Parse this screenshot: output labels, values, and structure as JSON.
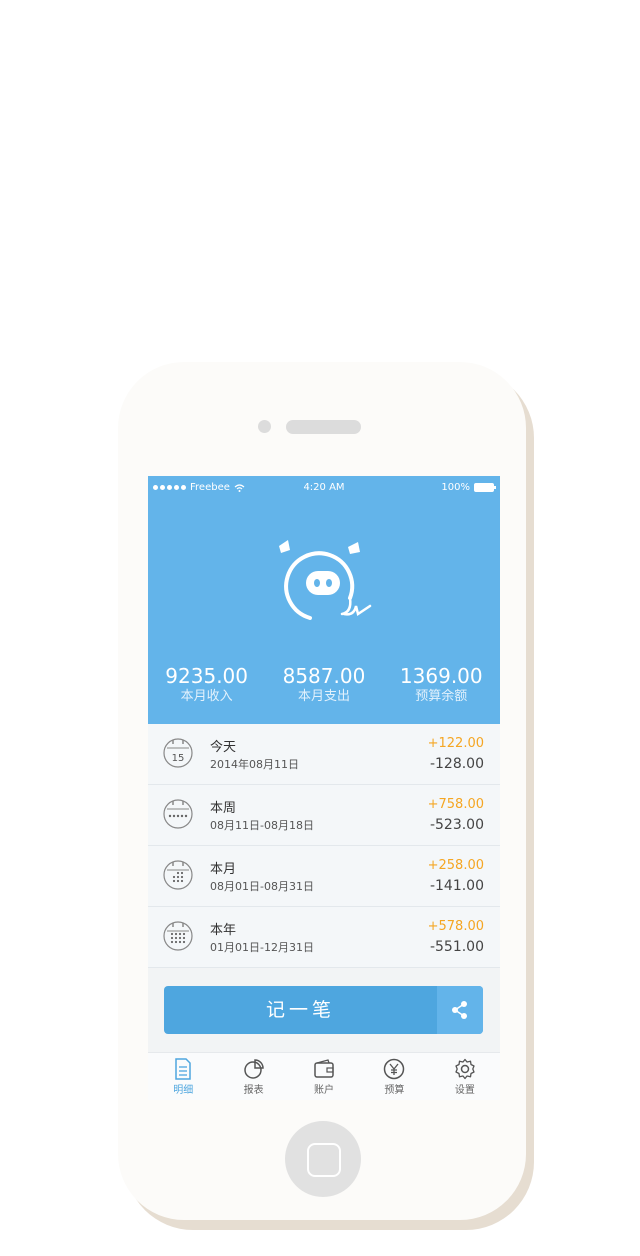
{
  "status_bar": {
    "carrier": "Freebee",
    "time": "4:20 AM",
    "battery": "100%"
  },
  "summary": {
    "income_value": "9235.00",
    "income_label": "本月收入",
    "expense_value": "8587.00",
    "expense_label": "本月支出",
    "budget_value": "1369.00",
    "budget_label": "预算余额"
  },
  "periods": [
    {
      "title": "今天",
      "date": "2014年08月11日",
      "income": "+122.00",
      "expense": "-128.00",
      "icon": "calendar-day-icon",
      "day": "15"
    },
    {
      "title": "本周",
      "date": "08月11日-08月18日",
      "income": "+758.00",
      "expense": "-523.00",
      "icon": "calendar-week-icon"
    },
    {
      "title": "本月",
      "date": "08月01日-08月31日",
      "income": "+258.00",
      "expense": "-141.00",
      "icon": "calendar-month-icon"
    },
    {
      "title": "本年",
      "date": "01月01日-12月31日",
      "income": "+578.00",
      "expense": "-551.00",
      "icon": "calendar-year-icon"
    }
  ],
  "record_button": {
    "label": "记一笔"
  },
  "tabs": [
    {
      "label": "明细",
      "icon": "document-icon",
      "active": true
    },
    {
      "label": "报表",
      "icon": "pie-chart-icon"
    },
    {
      "label": "账户",
      "icon": "wallet-icon"
    },
    {
      "label": "预算",
      "icon": "yen-icon"
    },
    {
      "label": "设置",
      "icon": "gear-icon"
    }
  ],
  "colors": {
    "header": "#63b4ea",
    "accent": "#4ea6df",
    "income": "#f5a623",
    "expense": "#444444"
  }
}
